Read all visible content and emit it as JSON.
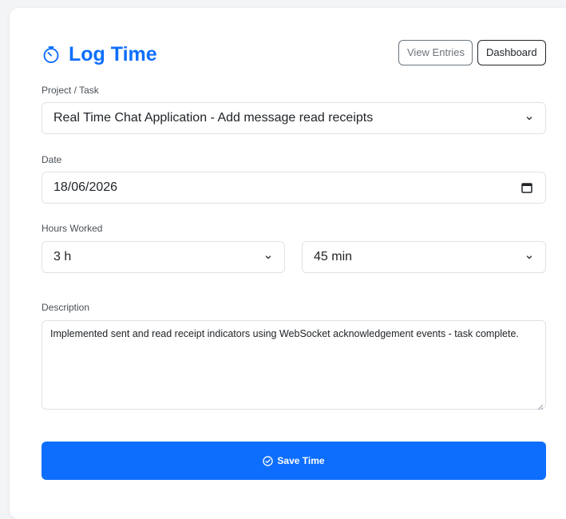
{
  "header": {
    "title": "Log Time",
    "title_icon": "stopwatch-icon",
    "view_entries_label": "View Entries",
    "dashboard_label": "Dashboard"
  },
  "form": {
    "project_label": "Project / Task",
    "project_value": "Real Time Chat Application - Add message read receipts",
    "date_label": "Date",
    "date_value": "18/06/2026",
    "hours_label": "Hours Worked",
    "hours_value": "3 h",
    "minutes_value": "45 min",
    "description_label": "Description",
    "description_value": "Implemented sent and read receipt indicators using WebSocket acknowledgement events - task complete."
  },
  "actions": {
    "save_label": "Save Time",
    "save_icon": "check-circle-icon"
  },
  "colors": {
    "accent": "#0d6efd",
    "secondary": "#6c757d",
    "border": "#dee2e6",
    "card_bg": "#ffffff",
    "page_bg": "#f3f4f6"
  }
}
